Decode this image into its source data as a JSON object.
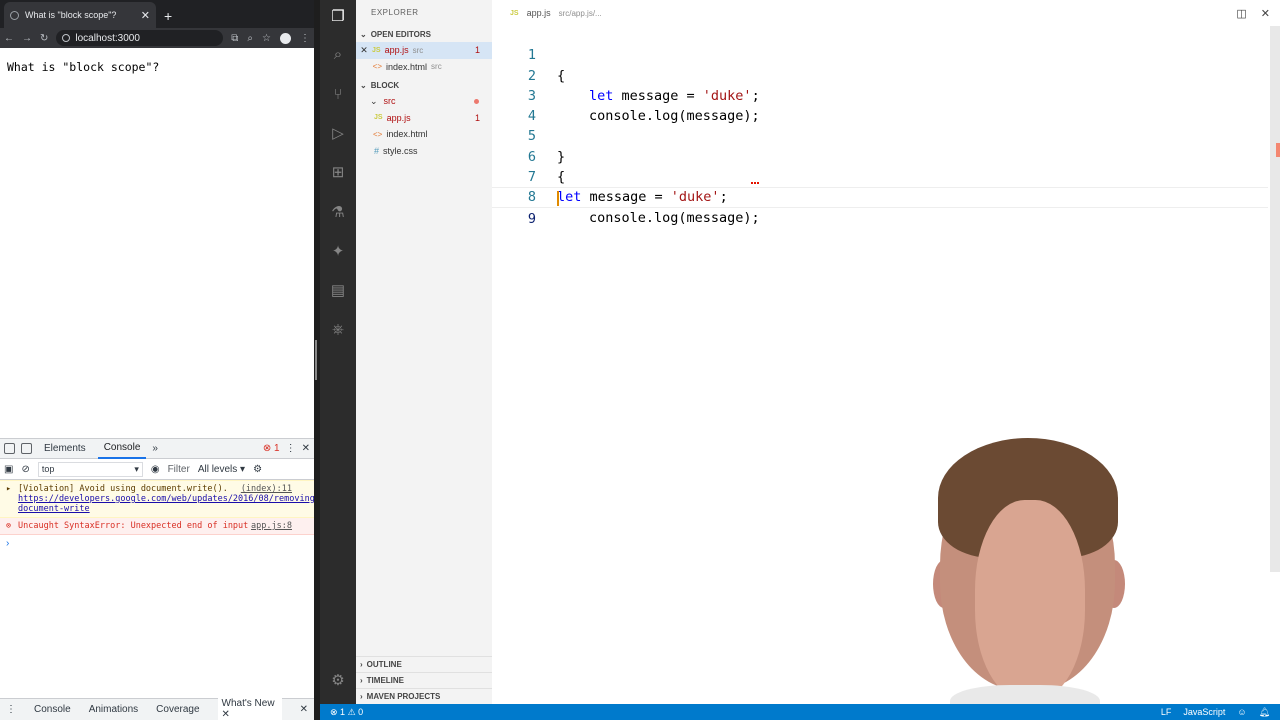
{
  "browser": {
    "tab_title": "What is \"block scope\"?",
    "url": "localhost:3000",
    "page_text": "What is \"block scope\"?"
  },
  "devtools": {
    "tabs": [
      "Elements",
      "Console"
    ],
    "error_count": "1",
    "context": "top",
    "filter_placeholder": "Filter",
    "levels": "All levels",
    "messages": {
      "violation_text": "[Violation] Avoid using document.write().",
      "violation_link": "https://developers.google.com/web/updates/2016/08/removing-document-write",
      "violation_source": "(index):11",
      "error_text": "Uncaught SyntaxError: Unexpected end of input",
      "error_source": "app.js:8"
    },
    "drawer_tabs": [
      "Console",
      "Animations",
      "Coverage",
      "What's New"
    ]
  },
  "vscode": {
    "explorer_title": "EXPLORER",
    "open_editors_label": "OPEN EDITORS",
    "open_editors": [
      {
        "name": "app.js",
        "folder": "src",
        "badge": "1"
      },
      {
        "name": "index.html",
        "folder": "src"
      }
    ],
    "project_label": "BLOCK",
    "folder": "src",
    "files": [
      {
        "name": "app.js",
        "badge": "1"
      },
      {
        "name": "index.html"
      },
      {
        "name": "style.css"
      }
    ],
    "bottom_sections": [
      "OUTLINE",
      "TIMELINE",
      "MAVEN PROJECTS"
    ],
    "breadcrumb_file": "app.js",
    "breadcrumb_path": "src/app.js/...",
    "line_numbers": [
      "1",
      "2",
      "3",
      "4",
      "5",
      "6",
      "7",
      "8",
      "9"
    ],
    "code": {
      "l1": "{",
      "l2_kw": "let",
      "l2_mid": " message = ",
      "l2_str": "'duke'",
      "l2_end": ";",
      "l3": "console.log(message);",
      "l5": "}",
      "l6": "{",
      "l7_kw": "let",
      "l7_mid": " message = ",
      "l7_str": "'duke'",
      "l7_end": ";",
      "l8": "console.log(message);"
    },
    "status": {
      "errors": "1",
      "warnings": "0",
      "eol": "LF",
      "language": "JavaScript"
    }
  },
  "colors": {
    "statusbar": "#007acc",
    "activitybar": "#2c2c2c",
    "keyword": "#0000ff",
    "string": "#a31515",
    "line_number": "#237893"
  }
}
